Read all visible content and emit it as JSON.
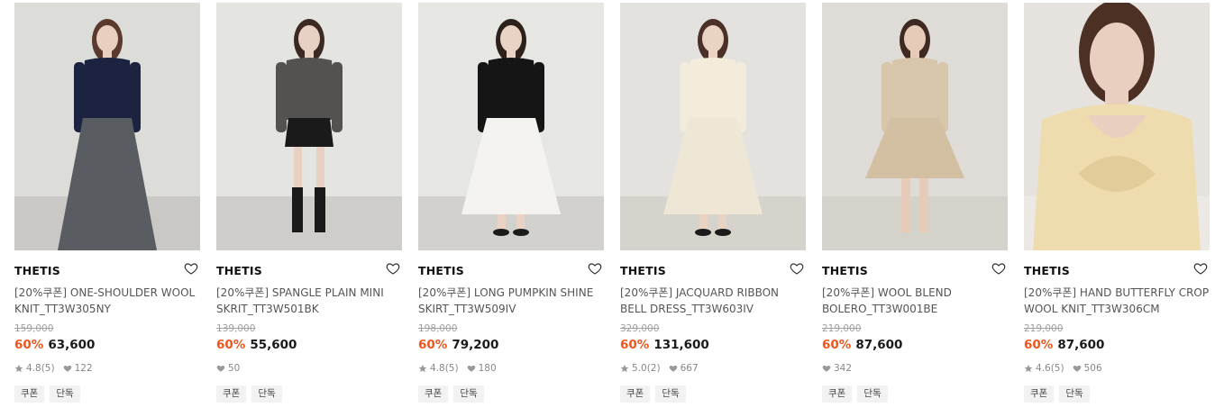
{
  "products": [
    {
      "brand": "THETIS",
      "name": "[20%쿠폰] ONE-SHOULDER WOOL KNIT_TT3W305NY",
      "original_price": "159,000",
      "discount": "60%",
      "price": "63,600",
      "rating": "4.8",
      "reviews": "(5)",
      "likes": "122",
      "tags": [
        "쿠폰",
        "단독"
      ],
      "colors": {
        "bg": "#dcdcd9",
        "top": "#1c2340",
        "bottom": "#595c61",
        "skin": "#e8cfc0",
        "hair": "#5a3a2c",
        "floor": "#c9c8c5"
      }
    },
    {
      "brand": "THETIS",
      "name": "[20%쿠폰] SPANGLE PLAIN MINI SKRIT_TT3W501BK",
      "original_price": "139,000",
      "discount": "60%",
      "price": "55,600",
      "rating": "",
      "reviews": "",
      "likes": "50",
      "tags": [
        "쿠폰",
        "단독"
      ],
      "colors": {
        "bg": "#e4e4e1",
        "top": "#545250",
        "bottom": "#1a1a1a",
        "skin": "#e8d1c2",
        "hair": "#3a2a22",
        "floor": "#cfcdca"
      }
    },
    {
      "brand": "THETIS",
      "name": "[20%쿠폰] LONG PUMPKIN SHINE SKIRT_TT3W509IV",
      "original_price": "198,000",
      "discount": "60%",
      "price": "79,200",
      "rating": "4.8",
      "reviews": "(5)",
      "likes": "180",
      "tags": [
        "쿠폰",
        "단독"
      ],
      "colors": {
        "bg": "#e6e6e3",
        "top": "#151515",
        "bottom": "#f4f3f0",
        "skin": "#ead3c4",
        "hair": "#2d211b",
        "floor": "#d3d1ce"
      }
    },
    {
      "brand": "THETIS",
      "name": "[20%쿠폰] JACQUARD RIBBON BELL DRESS_TT3W603IV",
      "original_price": "329,000",
      "discount": "60%",
      "price": "131,600",
      "rating": "5.0",
      "reviews": "(2)",
      "likes": "667",
      "tags": [
        "쿠폰",
        "단독"
      ],
      "colors": {
        "bg": "#e3e2df",
        "top": "#f3ecdc",
        "bottom": "#efe7d5",
        "skin": "#ebd3c3",
        "hair": "#4a3026",
        "floor": "#d6d3cd"
      }
    },
    {
      "brand": "THETIS",
      "name": "[20%쿠폰] WOOL BLEND BOLERO_TT3W001BE",
      "original_price": "219,000",
      "discount": "60%",
      "price": "87,600",
      "rating": "",
      "reviews": "",
      "likes": "342",
      "tags": [
        "쿠폰",
        "단독"
      ],
      "colors": {
        "bg": "#dfdcd8",
        "top": "#d8c6aa",
        "bottom": "#d3bfa2",
        "skin": "#e6cbb9",
        "hair": "#3e2a21",
        "floor": "#d5d1cb"
      }
    },
    {
      "brand": "THETIS",
      "name": "[20%쿠폰] HAND BUTTERFLY CROP WOOL KNIT_TT3W306CM",
      "original_price": "219,000",
      "discount": "60%",
      "price": "87,600",
      "rating": "4.6",
      "reviews": "(5)",
      "likes": "506",
      "tags": [
        "쿠폰",
        "단독"
      ],
      "colors": {
        "bg": "#e6e3df",
        "top": "#efdcae",
        "bottom": "#efdcae",
        "skin": "#e9cfbf",
        "hair": "#4c3024",
        "floor": "#ece8e3"
      }
    }
  ]
}
